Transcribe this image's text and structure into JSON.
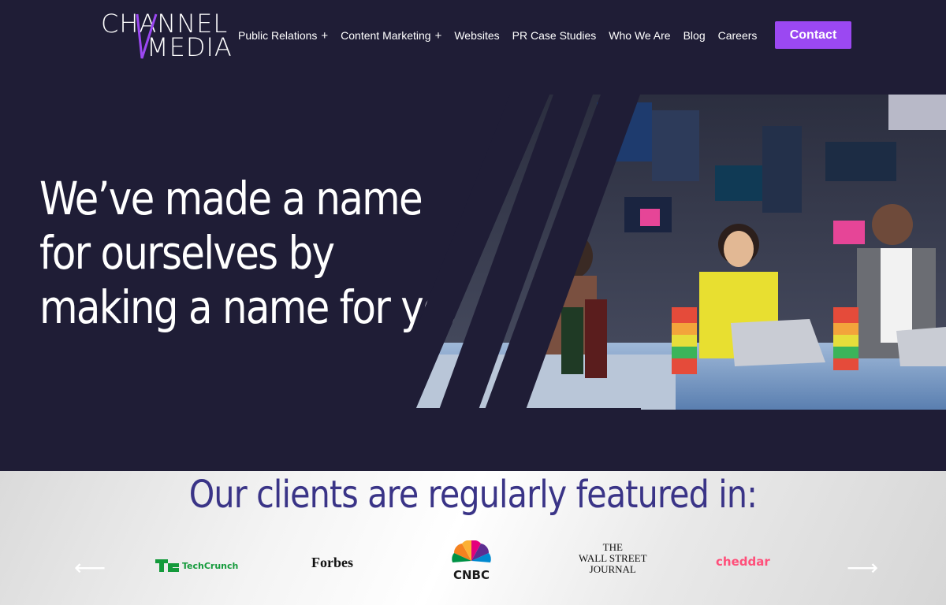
{
  "logo": {
    "line1": "CHANNEL",
    "line2": "MEDIA",
    "accent_color": "#9b48f2"
  },
  "nav": {
    "items": [
      {
        "label": "Public Relations",
        "has_submenu": true,
        "submenu_icon": "+"
      },
      {
        "label": "Content Marketing",
        "has_submenu": true,
        "submenu_icon": "+"
      },
      {
        "label": "Websites",
        "has_submenu": false
      },
      {
        "label": "PR Case Studies",
        "has_submenu": false
      },
      {
        "label": "Who We Are",
        "has_submenu": false
      },
      {
        "label": "Blog",
        "has_submenu": false
      },
      {
        "label": "Careers",
        "has_submenu": false
      }
    ],
    "contact_label": "Contact"
  },
  "hero": {
    "headline_lines": [
      "We’ve made a name",
      "for ourselves by",
      "making a name for you."
    ],
    "image_icon": "tv-studio-photo"
  },
  "featured": {
    "title": "Our clients are regularly featured in:",
    "prev_arrow": "⟵",
    "next_arrow": "⟶",
    "logos": [
      {
        "name": "TechCrunch",
        "mark": "TC"
      },
      {
        "name": "Forbes"
      },
      {
        "name": "CNBC"
      },
      {
        "name": "THE WALL STREET JOURNAL",
        "lines": [
          "THE",
          "WALL STREET",
          "JOURNAL"
        ]
      },
      {
        "name": "cheddar"
      }
    ]
  },
  "colors": {
    "background": "#1f1d36",
    "accent": "#9b48f2",
    "title_blue": "#3a3487"
  }
}
